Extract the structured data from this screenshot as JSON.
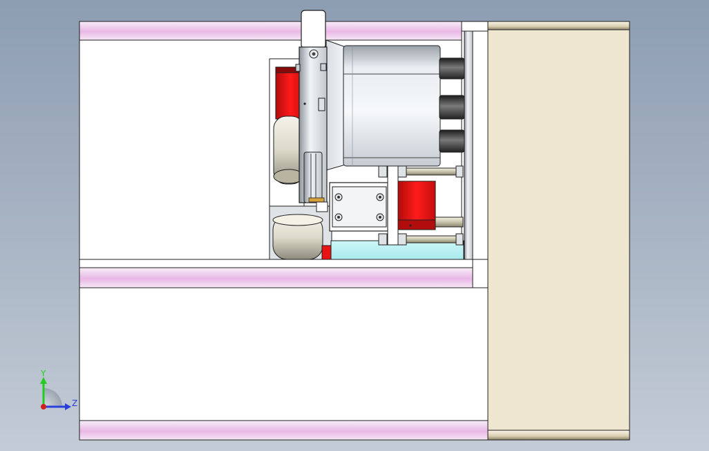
{
  "viewport": {
    "background_top": "#8d9db2",
    "background_bottom": "#c3cbd6"
  },
  "colors": {
    "frame_pink": "#e9b7e6",
    "panel_beige": "#efe6d0",
    "red_part": "#e81414",
    "cyan_part": "#bdf2f4",
    "steel": "#d8dde2",
    "dark_port": "#3a3a3a",
    "background": "#ffffff"
  },
  "triad": {
    "y_label": "Y",
    "z_label": "Z",
    "y_color": "#22cc22",
    "z_color": "#2a3fd9",
    "origin_color": "#d02020"
  }
}
